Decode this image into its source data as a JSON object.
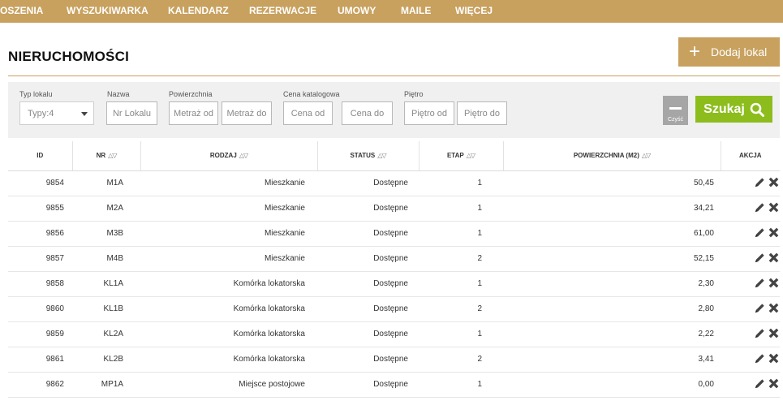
{
  "nav": [
    {
      "label": "OSZENIA"
    },
    {
      "label": "WYSZUKIWARKA"
    },
    {
      "label": "KALENDARZ"
    },
    {
      "label": "REZERWACJE"
    },
    {
      "label": "UMOWY"
    },
    {
      "label": "MAILE"
    },
    {
      "label": "WIĘCEJ"
    }
  ],
  "header": {
    "title": "NIERUCHOMOŚCI",
    "add_icon": "plus-icon",
    "add_label": "Dodaj lokal"
  },
  "filters": {
    "type_label": "Typ lokalu",
    "type_value": "Typy:4",
    "name_label": "Nazwa",
    "name_placeholder": "Nr Lokalu",
    "area_label": "Powierzchnia",
    "area_from_placeholder": "Metraż od",
    "area_to_placeholder": "Metraż do",
    "price_label": "Cena katalogowa",
    "price_from_placeholder": "Cena od",
    "price_to_placeholder": "Cena do",
    "floor_label": "Piętro",
    "floor_from_placeholder": "Piętro od",
    "floor_to_placeholder": "Piętro do",
    "clear_label": "Czyść",
    "search_label": "Szukaj",
    "search_icon": "search-icon"
  },
  "table": {
    "headers": {
      "id": "ID",
      "nr": "NR",
      "rodzaj": "RODZAJ",
      "status": "STATUS",
      "etap": "ETAP",
      "powierzchnia": "POWIERZCHNIA (M2)",
      "akcja": "AKCJA"
    },
    "rows": [
      {
        "id": "9854",
        "nr": "M1A",
        "rodzaj": "Mieszkanie",
        "status": "Dostępne",
        "etap": "1",
        "powierzchnia": "50,45"
      },
      {
        "id": "9855",
        "nr": "M2A",
        "rodzaj": "Mieszkanie",
        "status": "Dostępne",
        "etap": "1",
        "powierzchnia": "34,21"
      },
      {
        "id": "9856",
        "nr": "M3B",
        "rodzaj": "Mieszkanie",
        "status": "Dostępne",
        "etap": "1",
        "powierzchnia": "61,00"
      },
      {
        "id": "9857",
        "nr": "M4B",
        "rodzaj": "Mieszkanie",
        "status": "Dostępne",
        "etap": "2",
        "powierzchnia": "52,15"
      },
      {
        "id": "9858",
        "nr": "KL1A",
        "rodzaj": "Komórka lokatorska",
        "status": "Dostępne",
        "etap": "1",
        "powierzchnia": "2,30"
      },
      {
        "id": "9860",
        "nr": "KL1B",
        "rodzaj": "Komórka lokatorska",
        "status": "Dostępne",
        "etap": "2",
        "powierzchnia": "2,80"
      },
      {
        "id": "9859",
        "nr": "KL2A",
        "rodzaj": "Komórka lokatorska",
        "status": "Dostępne",
        "etap": "1",
        "powierzchnia": "2,22"
      },
      {
        "id": "9861",
        "nr": "KL2B",
        "rodzaj": "Komórka lokatorska",
        "status": "Dostępne",
        "etap": "2",
        "powierzchnia": "3,41"
      },
      {
        "id": "9862",
        "nr": "MP1A",
        "rodzaj": "Miejsce postojowe",
        "status": "Dostępne",
        "etap": "1",
        "powierzchnia": "0,00"
      }
    ]
  },
  "colors": {
    "accent": "#c8a15f",
    "search": "#8cbd1c",
    "clear": "#a6a6a6",
    "filter_bg": "#f0f0f0"
  }
}
